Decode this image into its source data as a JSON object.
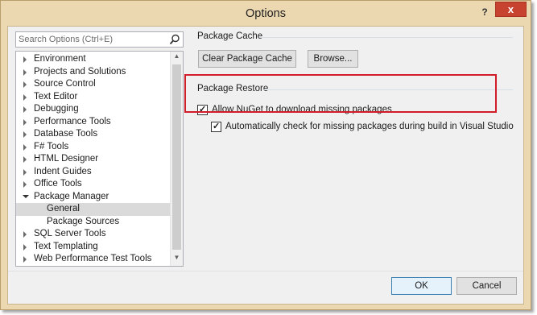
{
  "window": {
    "title": "Options",
    "help_glyph": "?",
    "close_glyph": "x"
  },
  "search": {
    "placeholder": "Search Options (Ctrl+E)"
  },
  "tree": {
    "items": [
      {
        "label": "Environment",
        "expanded": false,
        "level": 0
      },
      {
        "label": "Projects and Solutions",
        "expanded": false,
        "level": 0
      },
      {
        "label": "Source Control",
        "expanded": false,
        "level": 0
      },
      {
        "label": "Text Editor",
        "expanded": false,
        "level": 0
      },
      {
        "label": "Debugging",
        "expanded": false,
        "level": 0
      },
      {
        "label": "Performance Tools",
        "expanded": false,
        "level": 0
      },
      {
        "label": "Database Tools",
        "expanded": false,
        "level": 0
      },
      {
        "label": "F# Tools",
        "expanded": false,
        "level": 0
      },
      {
        "label": "HTML Designer",
        "expanded": false,
        "level": 0
      },
      {
        "label": "Indent Guides",
        "expanded": false,
        "level": 0
      },
      {
        "label": "Office Tools",
        "expanded": false,
        "level": 0
      },
      {
        "label": "Package Manager",
        "expanded": true,
        "level": 0
      },
      {
        "label": "General",
        "selected": true,
        "level": 1
      },
      {
        "label": "Package Sources",
        "level": 1
      },
      {
        "label": "SQL Server Tools",
        "expanded": false,
        "level": 0
      },
      {
        "label": "Text Templating",
        "expanded": false,
        "level": 0
      },
      {
        "label": "Web Performance Test Tools",
        "expanded": false,
        "level": 0
      }
    ]
  },
  "package_cache": {
    "heading": "Package Cache",
    "clear_button": "Clear Package Cache",
    "browse_button": "Browse..."
  },
  "package_restore": {
    "heading": "Package Restore",
    "allow_download": {
      "label": "Allow NuGet to download missing packages",
      "checked": true
    },
    "auto_check": {
      "label": "Automatically check for missing packages during build in Visual Studio",
      "checked": true
    }
  },
  "footer": {
    "ok_button": "OK",
    "cancel_button": "Cancel"
  },
  "colors": {
    "titlebar": "#ecd8b0",
    "close": "#c7432f",
    "highlight_box": "#d11c2a",
    "selected_row": "#dadada"
  }
}
